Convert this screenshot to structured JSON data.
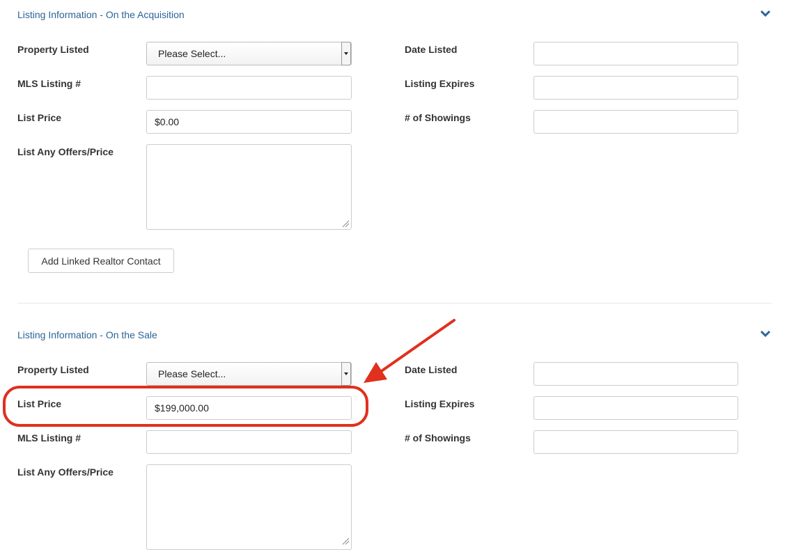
{
  "acquisition": {
    "title": "Listing Information - On the Acquisition",
    "property_listed_label": "Property Listed",
    "property_listed_value": "Please Select...",
    "mls_label": "MLS Listing #",
    "mls_value": "",
    "list_price_label": "List Price",
    "list_price_value": "$0.00",
    "offers_label": "List Any Offers/Price",
    "offers_value": "",
    "date_listed_label": "Date Listed",
    "date_listed_value": "",
    "listing_expires_label": "Listing Expires",
    "listing_expires_value": "",
    "showings_label": "# of Showings",
    "showings_value": "",
    "add_realtor_label": "Add Linked Realtor Contact"
  },
  "sale": {
    "title": "Listing Information - On the Sale",
    "property_listed_label": "Property Listed",
    "property_listed_value": "Please Select...",
    "list_price_label": "List Price",
    "list_price_value": "$199,000.00",
    "mls_label": "MLS Listing #",
    "mls_value": "",
    "offers_label": "List Any Offers/Price",
    "offers_value": "",
    "date_listed_label": "Date Listed",
    "date_listed_value": "",
    "listing_expires_label": "Listing Expires",
    "listing_expires_value": "",
    "showings_label": "# of Showings",
    "showings_value": ""
  },
  "colors": {
    "section_title": "#2a6496",
    "annotation": "#e0301e"
  },
  "icons": {
    "collapse": "chevron-down-icon",
    "select_arrow": "caret-down-icon",
    "annotation_arrow": "arrow-icon"
  }
}
